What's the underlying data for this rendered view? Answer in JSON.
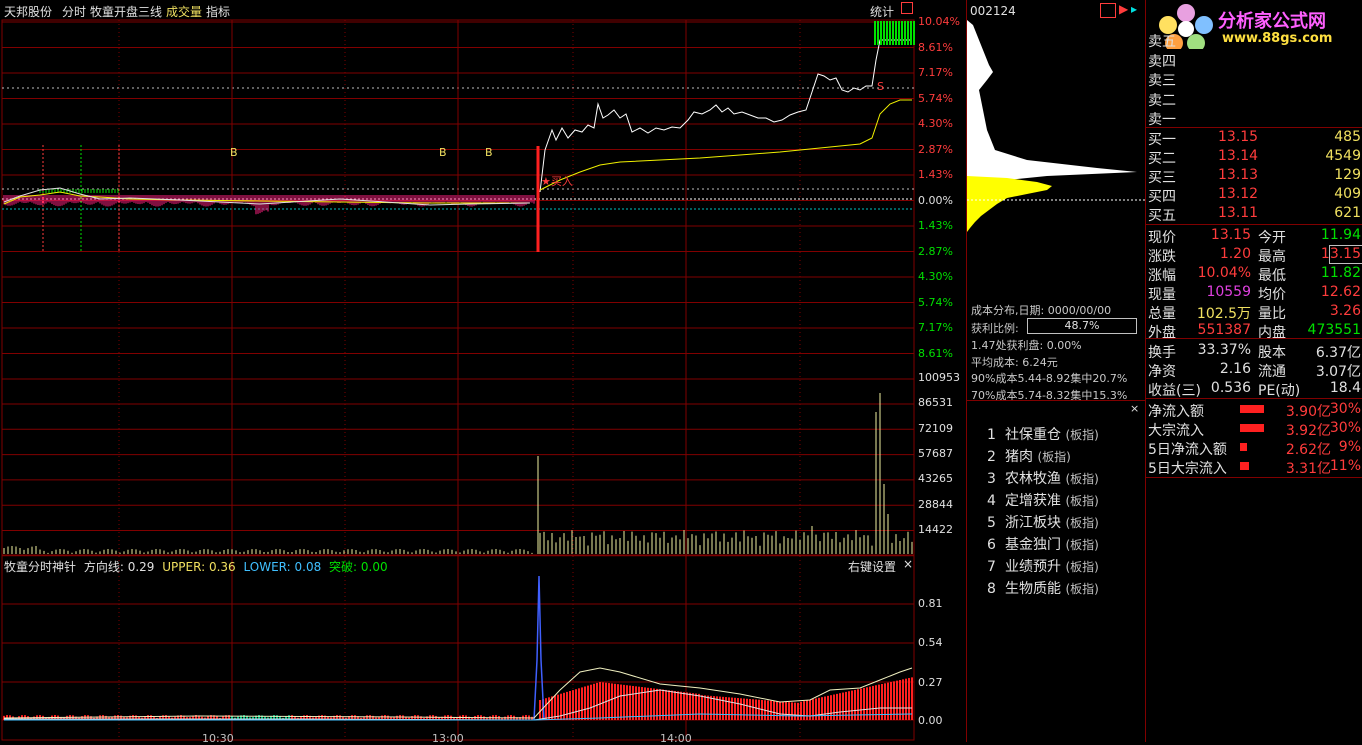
{
  "header": {
    "stock_name": "天邦股份",
    "mode": "分时",
    "indicator_title": "牧童开盘三线",
    "volume_label": "成交量",
    "index_label": "指标",
    "stats_label": "统计"
  },
  "price_axis": [
    "10.04%",
    "8.61%",
    "7.17%",
    "5.74%",
    "4.30%",
    "2.87%",
    "1.43%",
    "0.00%",
    "1.43%",
    "2.87%",
    "4.30%",
    "5.74%",
    "7.17%",
    "8.61%"
  ],
  "volume_axis": [
    "100953",
    "86531",
    "72109",
    "57687",
    "43265",
    "28844",
    "14422"
  ],
  "osc_axis": [
    "0.81",
    "0.54",
    "0.27",
    "0.00"
  ],
  "time_axis": [
    "10:30",
    "13:00",
    "14:00"
  ],
  "markers": {
    "b": "B",
    "s": "S",
    "buy": "买入"
  },
  "sub_indicator": {
    "name": "牧童分时神针",
    "direction_label": "方向线:",
    "direction_value": "0.29",
    "upper_label": "UPPER:",
    "upper_value": "0.36",
    "lower_label": "LOWER:",
    "lower_value": "0.08",
    "break_label": "突破:",
    "break_value": "0.00",
    "settings": "右键设置",
    "close": "×"
  },
  "mid": {
    "code": "002124",
    "cost_title": "成本分布,日期: 0000/00/00",
    "profit_label": "获利比例:",
    "profit_value": "48.7%",
    "profit_at": "1.47处获利盘: 0.00%",
    "avg_cost": "平均成本: 6.24元",
    "cost90": "90%成本5.44-8.92集中20.7%",
    "cost70": "70%成本5.74-8.32集中15.3%",
    "blocks": [
      {
        "num": "1",
        "name": "社保重仓",
        "tag": "(板指)"
      },
      {
        "num": "2",
        "name": "猪肉",
        "tag": "(板指)"
      },
      {
        "num": "3",
        "name": "农林牧渔",
        "tag": "(板指)"
      },
      {
        "num": "4",
        "name": "定增获准",
        "tag": "(板指)"
      },
      {
        "num": "5",
        "name": "浙江板块",
        "tag": "(板指)"
      },
      {
        "num": "6",
        "name": "基金独门",
        "tag": "(板指)"
      },
      {
        "num": "7",
        "name": "业绩预升",
        "tag": "(板指)"
      },
      {
        "num": "8",
        "name": "生物质能",
        "tag": "(板指)"
      }
    ]
  },
  "logo": {
    "title": "分析家公式网",
    "url": "www.88gs.com"
  },
  "sells": [
    "卖五",
    "卖四",
    "卖三",
    "卖二",
    "卖一"
  ],
  "buys": [
    {
      "label": "买一",
      "price": "13.15",
      "vol": "485"
    },
    {
      "label": "买二",
      "price": "13.14",
      "vol": "4549"
    },
    {
      "label": "买三",
      "price": "13.13",
      "vol": "129"
    },
    {
      "label": "买四",
      "price": "13.12",
      "vol": "409"
    },
    {
      "label": "买五",
      "price": "13.11",
      "vol": "621"
    }
  ],
  "quote": [
    {
      "l1": "现价",
      "v1": "13.15",
      "c1": "#ff3c3c",
      "l2": "今开",
      "v2": "11.94",
      "c2": "#00e000"
    },
    {
      "l1": "涨跌",
      "v1": "1.20",
      "c1": "#ff3c3c",
      "l2": "最高",
      "v2": "13.15",
      "c2": "#ff3c3c"
    },
    {
      "l1": "涨幅",
      "v1": "10.04%",
      "c1": "#ff3c3c",
      "l2": "最低",
      "v2": "11.82",
      "c2": "#00e000"
    },
    {
      "l1": "现量",
      "v1": "10559",
      "c1": "#e040e0",
      "l2": "均价",
      "v2": "12.62",
      "c2": "#ff3c3c"
    },
    {
      "l1": "总量",
      "v1": "102.5万",
      "c1": "#f0e060",
      "l2": "量比",
      "v2": "3.26",
      "c2": "#ff3c3c"
    },
    {
      "l1": "外盘",
      "v1": "551387",
      "c1": "#ff3c3c",
      "l2": "内盘",
      "v2": "473551",
      "c2": "#00e000"
    }
  ],
  "finance": [
    {
      "l1": "换手",
      "v1": "33.37%",
      "l2": "股本",
      "v2": "6.37亿"
    },
    {
      "l1": "净资",
      "v1": "2.16",
      "l2": "流通",
      "v2": "3.07亿"
    },
    {
      "l1": "收益(三)",
      "v1": "0.536",
      "l2": "PE(动)",
      "v2": "18.4"
    }
  ],
  "flows": [
    {
      "label": "净流入额",
      "value": "3.90亿",
      "pct": "30%",
      "ratio": 0.3
    },
    {
      "label": "大宗流入",
      "value": "3.92亿",
      "pct": "30%",
      "ratio": 0.3
    },
    {
      "label": "5日净流入额",
      "value": "2.62亿",
      "pct": "9%",
      "ratio": 0.09
    },
    {
      "label": "5日大宗流入",
      "value": "3.31亿",
      "pct": "11%",
      "ratio": 0.11
    }
  ],
  "colors": {
    "up": "#ff3c3c",
    "down": "#00e000",
    "grid": "#800000",
    "avg": "#f0f000",
    "price": "#ffffff"
  }
}
